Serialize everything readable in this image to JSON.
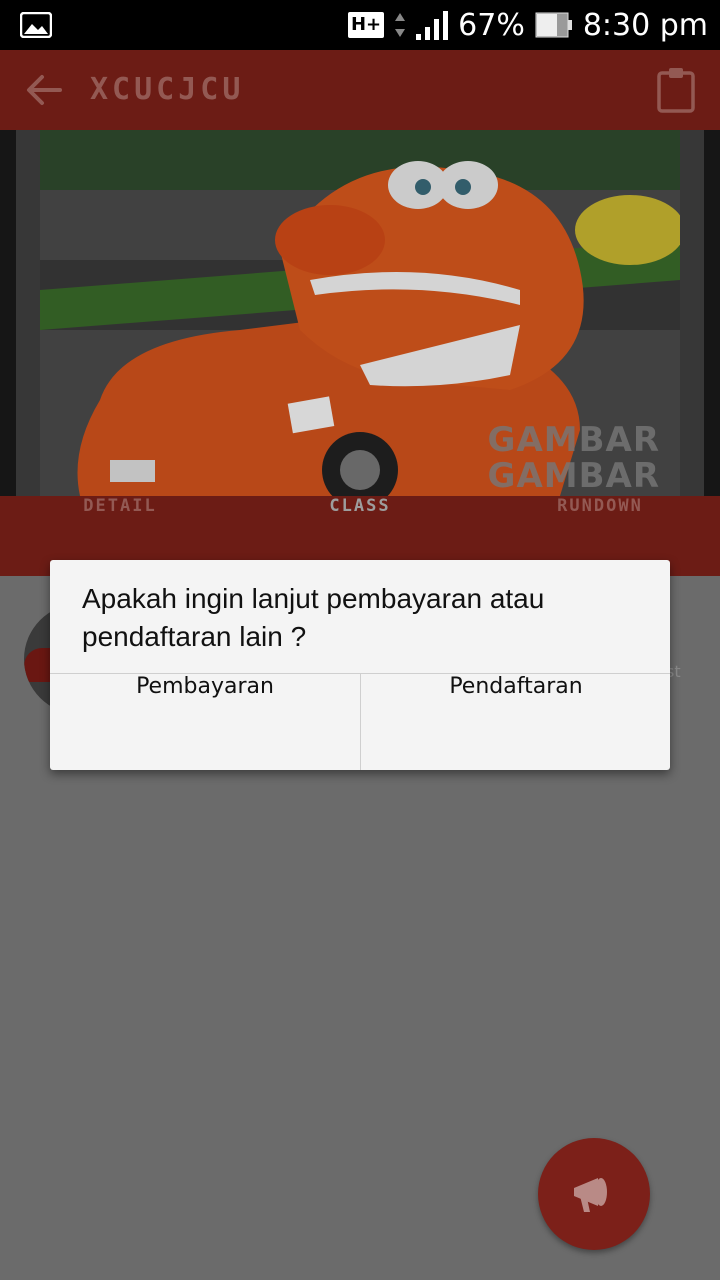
{
  "status_bar": {
    "network": "H+",
    "battery_percent": "67%",
    "time": "8:30 pm"
  },
  "app_bar": {
    "title": "XCUCJCU"
  },
  "hero": {
    "watermark_line1": "GAMBAR",
    "watermark_line2": "GAMBAR"
  },
  "tabs": [
    {
      "label": "DETAIL",
      "active": false
    },
    {
      "label": "CLASS",
      "active": true
    },
    {
      "label": "RUNDOWN",
      "active": false
    }
  ],
  "content": {
    "partial_text": "st"
  },
  "dialog": {
    "message": "Apakah ingin lanjut pembayaran atau pendaftaran lain ?",
    "left_button": "Pembayaran",
    "right_button": "Pendaftaran"
  },
  "colors": {
    "primary": "#7c2019",
    "content_bg": "#6b6b6b",
    "dialog_bg": "#f4f4f4"
  }
}
